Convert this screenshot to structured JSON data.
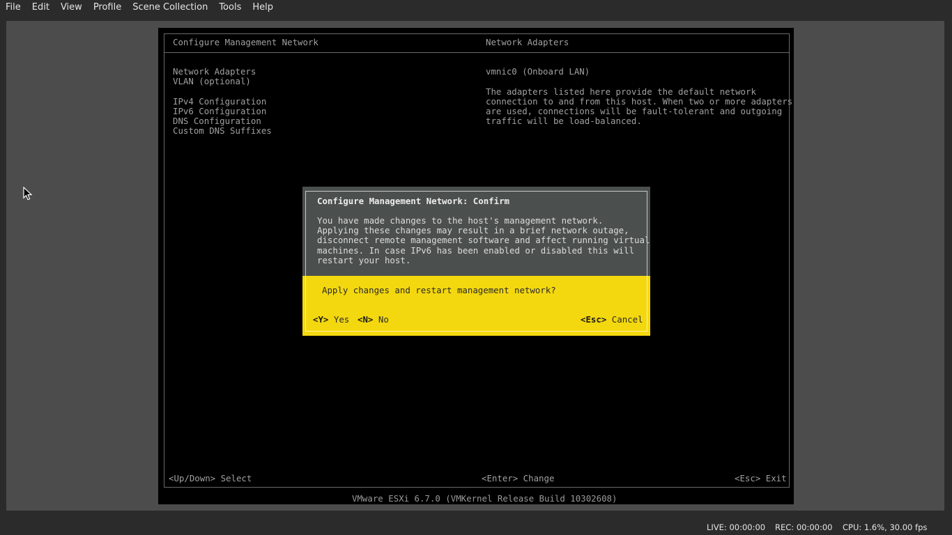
{
  "menu": {
    "items": [
      "File",
      "Edit",
      "View",
      "Profile",
      "Scene Collection",
      "Tools",
      "Help"
    ]
  },
  "console": {
    "left_header": "Configure Management Network",
    "right_header": "Network Adapters",
    "nav": [
      "Network Adapters",
      "VLAN (optional)",
      "IPv4 Configuration",
      "IPv6 Configuration",
      "DNS Configuration",
      "Custom DNS Suffixes"
    ],
    "adapter": "vmnic0 (Onboard LAN)",
    "description": [
      "The adapters listed here provide the default network",
      "connection to and from this host. When two or more adapters",
      "are used, connections will be fault-tolerant and outgoing",
      "traffic will be load-balanced."
    ],
    "footer": {
      "left": "<Up/Down> Select",
      "center": "<Enter> Change",
      "right": "<Esc> Exit"
    },
    "version": "VMware ESXi 6.7.0 (VMKernel Release Build 10302608)"
  },
  "dialog": {
    "title": "Configure Management Network: Confirm",
    "body": [
      "You have made changes to the host's management network.",
      "Applying these changes may result in a brief network outage,",
      "disconnect remote management software and affect running virtual",
      "machines. In case IPv6 has been enabled or disabled this will",
      "restart your host."
    ],
    "question": "Apply changes and restart management network?",
    "yes_key": "<Y>",
    "yes_label": "Yes",
    "no_key": "<N>",
    "no_label": "No",
    "cancel_key": "<Esc>",
    "cancel_label": "Cancel"
  },
  "status": {
    "live": "LIVE: 00:00:00",
    "rec": "REC: 00:00:00",
    "cpu": "CPU: 1.6%, 30.00 fps"
  },
  "colors": {
    "dialog_yellow": "#f4d80f",
    "dialog_gray": "#4b504e",
    "console_bg": "#000000"
  }
}
